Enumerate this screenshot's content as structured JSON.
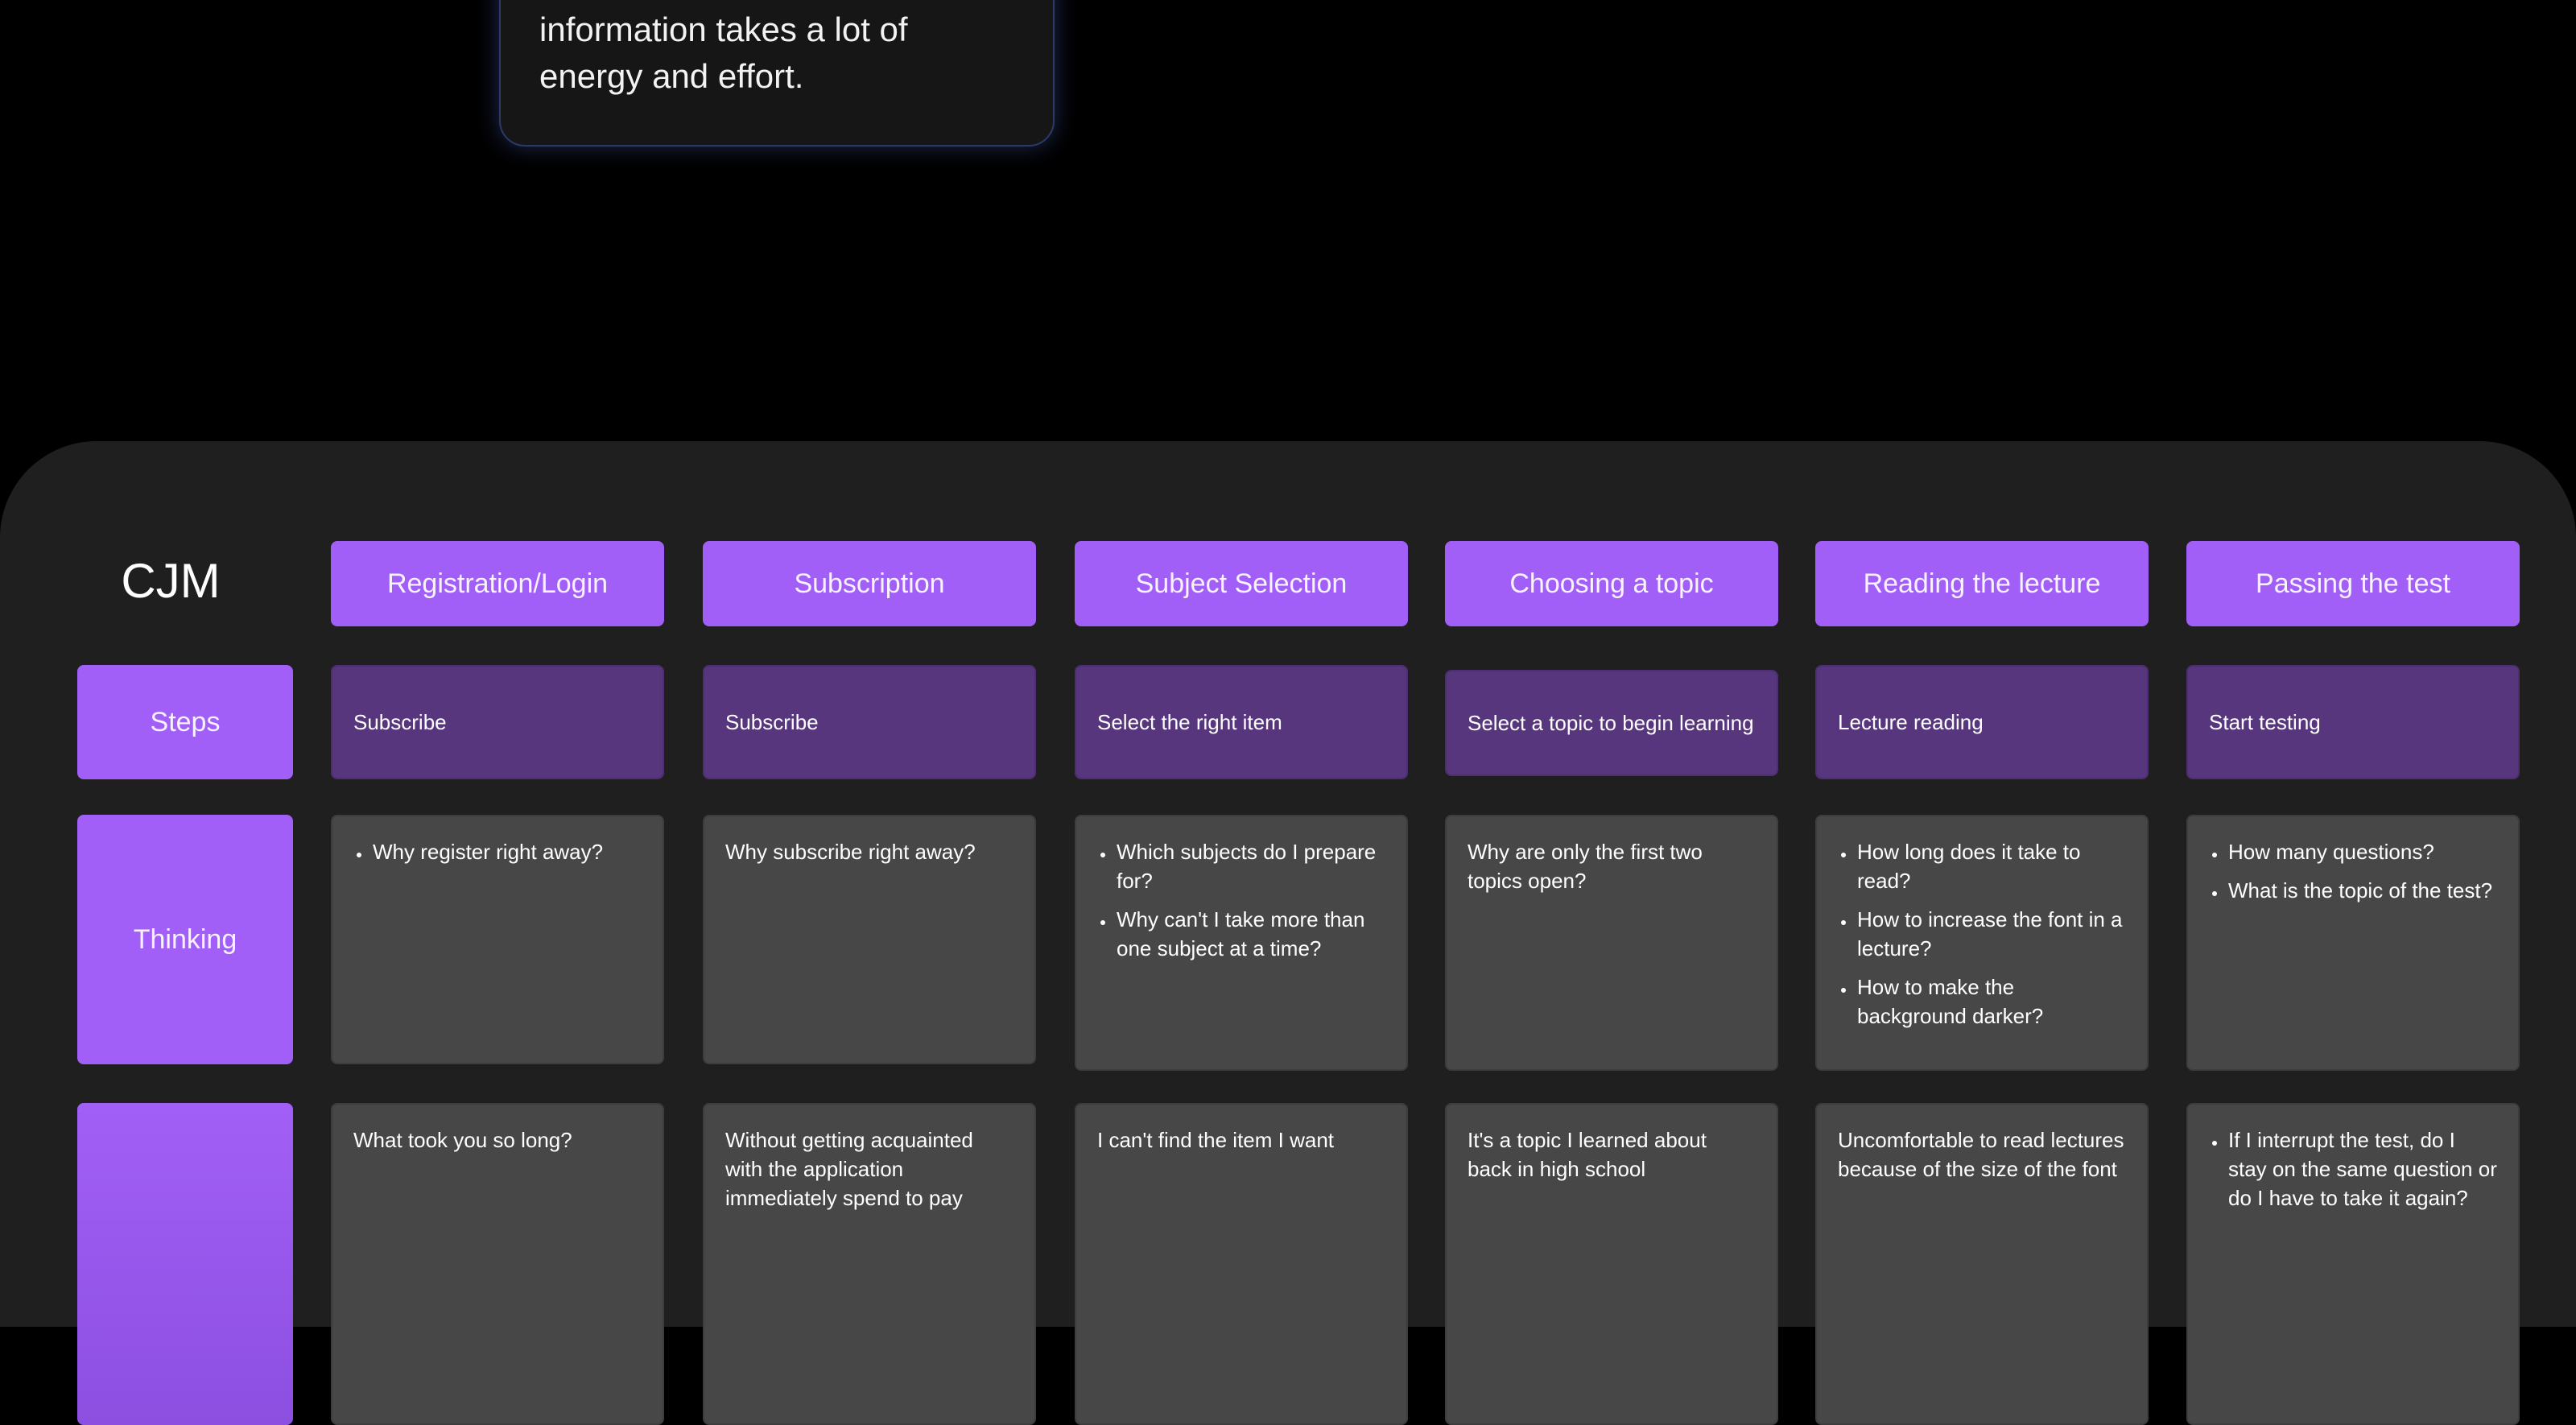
{
  "quote_card": {
    "lines": [
      "information takes a lot of",
      "energy and effort."
    ]
  },
  "cjm": {
    "title": "CJM",
    "stages": [
      "Registration/Login",
      "Subscription",
      "Subject Selection",
      "Choosing a topic",
      "Reading the lecture",
      "Passing the test"
    ],
    "rows": {
      "steps_label": "Steps",
      "thinking_label": "Thinking",
      "emotions_label": ""
    },
    "steps": [
      "Subscribe",
      "Subscribe",
      "Select the right item",
      "Select a topic to begin learning",
      "Lecture reading",
      "Start testing"
    ],
    "thinking": [
      {
        "bulleted": true,
        "items": [
          "Why register right away?"
        ]
      },
      {
        "bulleted": false,
        "items": [
          "Why subscribe right away?"
        ]
      },
      {
        "bulleted": true,
        "items": [
          "Which subjects do I prepare for?",
          "Why can't I take more than one subject at a time?"
        ]
      },
      {
        "bulleted": false,
        "items": [
          "Why are only the first two topics open?"
        ]
      },
      {
        "bulleted": true,
        "items": [
          "How long does it take to read?",
          "How to increase the font in a lecture?",
          "How to make the background darker?"
        ]
      },
      {
        "bulleted": true,
        "items": [
          "How many questions?",
          "What is the topic of the test?"
        ]
      }
    ],
    "feeling": [
      {
        "bulleted": false,
        "items": [
          "What took you so long?"
        ]
      },
      {
        "bulleted": false,
        "items": [
          "Without getting acquainted with the application immediately spend to pay"
        ]
      },
      {
        "bulleted": false,
        "items": [
          "I can't find the item I want"
        ]
      },
      {
        "bulleted": false,
        "items": [
          "It's a topic I learned about back in high school"
        ]
      },
      {
        "bulleted": false,
        "items": [
          "Uncomfortable to read lectures because of the size of the font"
        ]
      },
      {
        "bulleted": true,
        "items": [
          "If I interrupt the test, do I stay on the same question or do I have to take it again?"
        ]
      }
    ]
  },
  "colors": {
    "background": "#000000",
    "panel": "#1f1f1f",
    "accent": "#a25ff7",
    "step_card": "#57367e",
    "note_card": "#474747"
  }
}
